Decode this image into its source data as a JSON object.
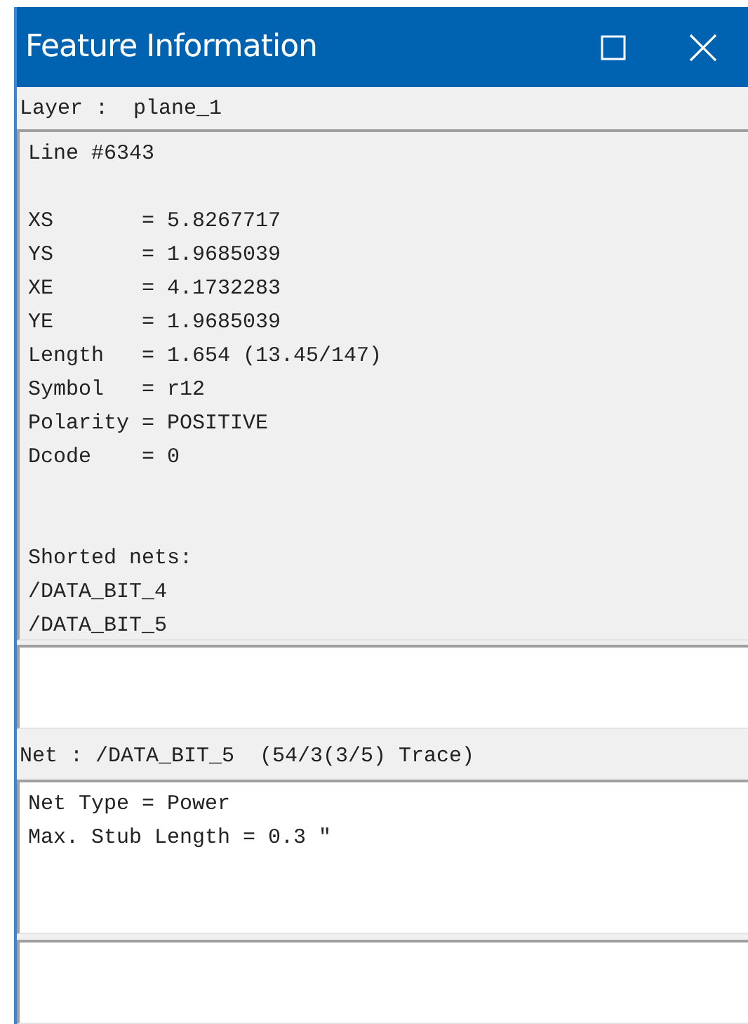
{
  "window": {
    "title": "Feature Information"
  },
  "layer": "Layer :  plane_1",
  "feature": {
    "heading": "Line #6343",
    "attributes": [
      "XS       = 5.8267717",
      "YS       = 1.9685039",
      "XE       = 4.1732283",
      "YE       = 1.9685039",
      "Length   = 1.654 (13.45/147)",
      "Symbol   = r12",
      "Polarity = POSITIVE",
      "Dcode    = 0"
    ],
    "shorted_nets": {
      "title": "Shorted nets:",
      "items": [
        "/DATA_BIT_4",
        "/DATA_BIT_5"
      ]
    }
  },
  "net": "Net : /DATA_BIT_5  (54/3(3/5) Trace)",
  "net_details": [
    "Net Type = Power",
    "Max. Stub Length = 0.3 \""
  ]
}
